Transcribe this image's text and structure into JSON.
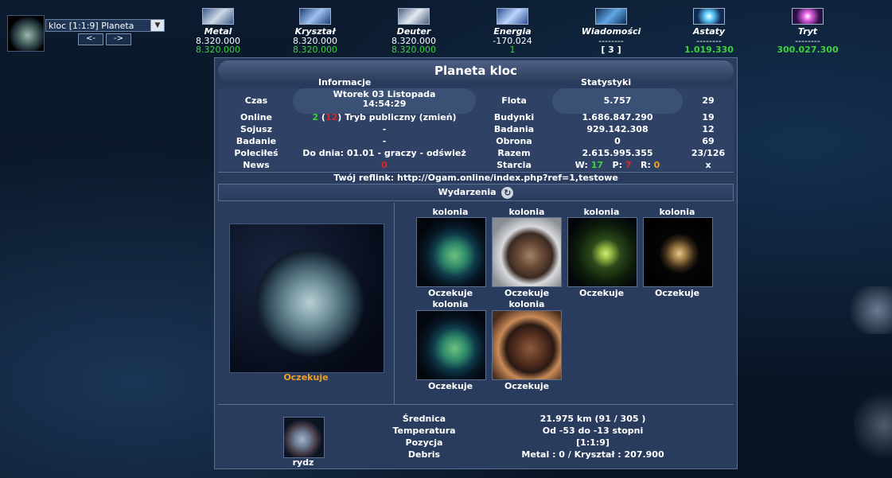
{
  "planet_selector": {
    "selected": "kloc [1:1:9] Planeta",
    "prev": "<-",
    "next": "->"
  },
  "resources": [
    {
      "name": "Metal",
      "line1": "8.320.000",
      "line2": "8.320.000",
      "icon": "metal-icon"
    },
    {
      "name": "Kryształ",
      "line1": "8.320.000",
      "line2": "8.320.000",
      "icon": "crystal-icon"
    },
    {
      "name": "Deuter",
      "line1": "8.320.000",
      "line2": "8.320.000",
      "icon": "deuterium-icon"
    },
    {
      "name": "Energia",
      "line1": "-170.024",
      "line2": "1",
      "icon": "energy-icon"
    },
    {
      "name": "Wiadomości",
      "line1": "--------",
      "line2": "[ 3 ]",
      "icon": "messages-icon"
    },
    {
      "name": "Astaty",
      "line1": "--------",
      "line2": "1.019.330",
      "icon": "astatine-icon"
    },
    {
      "name": "Tryt",
      "line1": "--------",
      "line2": "300.027.300",
      "icon": "tritium-icon"
    }
  ],
  "panel": {
    "title": "Planeta kloc",
    "info_header": "Informacje",
    "stats_header": "Statystyki",
    "czas_label": "Czas",
    "czas_date": "Wtorek 03 Listopada",
    "czas_time": "14:54:29",
    "online_label": "Online",
    "online_green": "2",
    "online_open": " (",
    "online_red": "12",
    "online_rest": ") Tryb publiczny (zmień)",
    "sojusz_label": "Sojusz",
    "sojusz_value": "-",
    "badanie_label": "Badanie",
    "badanie_value": "-",
    "polecil_label": "Poleciłeś",
    "polecil_value": "Do dnia: 01.01 - graczy - odśwież",
    "news_label": "News",
    "news_value": "0",
    "stats": [
      {
        "label": "Flota",
        "value": "5.757",
        "rank": "29"
      },
      {
        "label": "Budynki",
        "value": "1.686.847.290",
        "rank": "19"
      },
      {
        "label": "Badania",
        "value": "929.142.308",
        "rank": "12"
      },
      {
        "label": "Obrona",
        "value": "0",
        "rank": "69"
      },
      {
        "label": "Razem",
        "value": "2.615.995.355",
        "rank": "23/126"
      }
    ],
    "starcia_label": "Starcia",
    "starcia_w_label": "W: ",
    "starcia_w": "17",
    "starcia_p_label": "P: ",
    "starcia_p": "7",
    "starcia_r_label": "R: ",
    "starcia_r": "0",
    "starcia_rank": "x",
    "reflink": "Twój reflink: http://Ogam.online/index.php?ref=1,testowe",
    "events": "Wydarzenia",
    "main_planet_status": "Oczekuje",
    "colonies": [
      {
        "label": "kolonia",
        "status": "Oczekuje"
      },
      {
        "label": "kolonia",
        "status": "Oczekuje"
      },
      {
        "label": "kolonia",
        "status": "Oczekuje"
      },
      {
        "label": "kolonia",
        "status": "Oczekuje"
      },
      {
        "label": "kolonia",
        "status": "Oczekuje"
      },
      {
        "label": "kolonia",
        "status": "Oczekuje"
      }
    ],
    "moon_name": "rydz",
    "details": [
      {
        "label": "Średnica",
        "value": "21.975 km (91 / 305 )"
      },
      {
        "label": "Temperatura",
        "value": "Od -53 do -13 stopni"
      },
      {
        "label": "Pozycja",
        "value": "[1:1:9]"
      },
      {
        "label": "Debris",
        "value": "Metal : 0 / Kryształ : 207.900"
      }
    ]
  },
  "colors": {
    "accent_green": "#3dd23d",
    "accent_red": "#e02525",
    "accent_orange": "#f2a01e",
    "accent_yellow": "#f5d400",
    "panel_bg": "#2a3c5e"
  }
}
